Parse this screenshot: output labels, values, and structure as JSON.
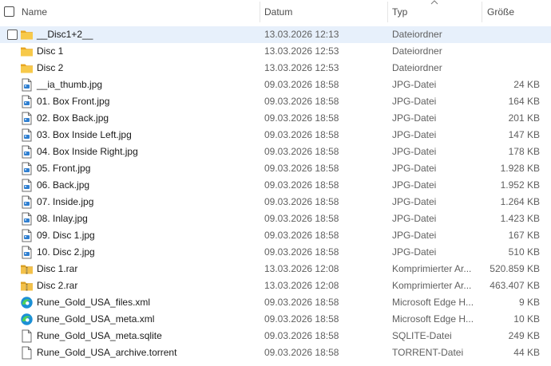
{
  "columns": {
    "name": "Name",
    "date": "Datum",
    "type": "Typ",
    "size": "Größe"
  },
  "files": [
    {
      "name": "__Disc1+2__",
      "date": "13.03.2026 12:13",
      "type": "Dateiordner",
      "size": "",
      "icon": "folder-icon",
      "selected": true
    },
    {
      "name": "Disc 1",
      "date": "13.03.2026 12:53",
      "type": "Dateiordner",
      "size": "",
      "icon": "folder-icon"
    },
    {
      "name": "Disc 2",
      "date": "13.03.2026 12:53",
      "type": "Dateiordner",
      "size": "",
      "icon": "folder-icon"
    },
    {
      "name": "__ia_thumb.jpg",
      "date": "09.03.2026 18:58",
      "type": "JPG-Datei",
      "size": "24 KB",
      "icon": "image-file-icon"
    },
    {
      "name": "01. Box Front.jpg",
      "date": "09.03.2026 18:58",
      "type": "JPG-Datei",
      "size": "164 KB",
      "icon": "image-file-icon"
    },
    {
      "name": "02. Box Back.jpg",
      "date": "09.03.2026 18:58",
      "type": "JPG-Datei",
      "size": "201 KB",
      "icon": "image-file-icon"
    },
    {
      "name": "03. Box Inside Left.jpg",
      "date": "09.03.2026 18:58",
      "type": "JPG-Datei",
      "size": "147 KB",
      "icon": "image-file-icon"
    },
    {
      "name": "04. Box Inside Right.jpg",
      "date": "09.03.2026 18:58",
      "type": "JPG-Datei",
      "size": "178 KB",
      "icon": "image-file-icon"
    },
    {
      "name": "05. Front.jpg",
      "date": "09.03.2026 18:58",
      "type": "JPG-Datei",
      "size": "1.928 KB",
      "icon": "image-file-icon"
    },
    {
      "name": "06. Back.jpg",
      "date": "09.03.2026 18:58",
      "type": "JPG-Datei",
      "size": "1.952 KB",
      "icon": "image-file-icon"
    },
    {
      "name": "07. Inside.jpg",
      "date": "09.03.2026 18:58",
      "type": "JPG-Datei",
      "size": "1.264 KB",
      "icon": "image-file-icon"
    },
    {
      "name": "08. Inlay.jpg",
      "date": "09.03.2026 18:58",
      "type": "JPG-Datei",
      "size": "1.423 KB",
      "icon": "image-file-icon"
    },
    {
      "name": "09. Disc 1.jpg",
      "date": "09.03.2026 18:58",
      "type": "JPG-Datei",
      "size": "167 KB",
      "icon": "image-file-icon"
    },
    {
      "name": "10. Disc 2.jpg",
      "date": "09.03.2026 18:58",
      "type": "JPG-Datei",
      "size": "510 KB",
      "icon": "image-file-icon"
    },
    {
      "name": "Disc 1.rar",
      "date": "13.03.2026 12:08",
      "type": "Komprimierter Ar...",
      "size": "520.859 KB",
      "icon": "archive-icon"
    },
    {
      "name": "Disc 2.rar",
      "date": "13.03.2026 12:08",
      "type": "Komprimierter Ar...",
      "size": "463.407 KB",
      "icon": "archive-icon"
    },
    {
      "name": "Rune_Gold_USA_files.xml",
      "date": "09.03.2026 18:58",
      "type": "Microsoft Edge H...",
      "size": "9 KB",
      "icon": "edge-icon"
    },
    {
      "name": "Rune_Gold_USA_meta.xml",
      "date": "09.03.2026 18:58",
      "type": "Microsoft Edge H...",
      "size": "10 KB",
      "icon": "edge-icon"
    },
    {
      "name": "Rune_Gold_USA_meta.sqlite",
      "date": "09.03.2026 18:58",
      "type": "SQLITE-Datei",
      "size": "249 KB",
      "icon": "file-icon"
    },
    {
      "name": "Rune_Gold_USA_archive.torrent",
      "date": "09.03.2026 18:58",
      "type": "TORRENT-Datei",
      "size": "44 KB",
      "icon": "file-icon"
    }
  ],
  "colors": {
    "selection": "#e7f0fb",
    "folder": "#f3bd3d",
    "image_file": "#2f7fd1",
    "edge": "#1b8fd6"
  }
}
